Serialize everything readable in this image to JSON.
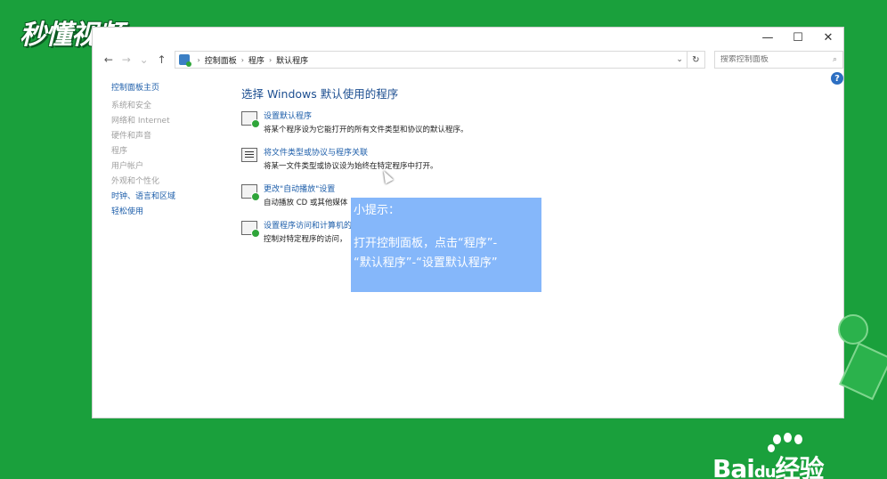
{
  "watermark": {
    "logo_text": "秒懂视频",
    "baidu_text": "Bai",
    "baidu_suffix": "经验",
    "du_text": "du"
  },
  "window": {
    "controls": {
      "minimize": "—",
      "maximize": "☐",
      "close": "✕"
    },
    "address": {
      "back": "←",
      "forward": "→",
      "recent": "⌄",
      "up": "↑",
      "breadcrumb": [
        "控制面板",
        "程序",
        "默认程序"
      ],
      "separator": "›",
      "dropdown": "⌄",
      "refresh": "↻"
    },
    "search": {
      "placeholder": "搜索控制面板",
      "icon": "⌕"
    },
    "help": "?"
  },
  "sidebar": {
    "home": "控制面板主页",
    "items": [
      {
        "label": "系统和安全"
      },
      {
        "label": "网络和 Internet"
      },
      {
        "label": "硬件和声音"
      },
      {
        "label": "程序"
      },
      {
        "label": "用户帐户"
      },
      {
        "label": "外观和个性化"
      },
      {
        "label": "时钟、语言和区域"
      },
      {
        "label": "轻松使用"
      }
    ]
  },
  "main": {
    "title": "选择 Windows 默认使用的程序",
    "tasks": [
      {
        "link": "设置默认程序",
        "desc": "将某个程序设为它能打开的所有文件类型和协议的默认程序。"
      },
      {
        "link": "将文件类型或协议与程序关联",
        "desc": "将某一文件类型或协议设为始终在特定程序中打开。"
      },
      {
        "link": "更改\"自动播放\"设置",
        "desc": "自动播放 CD 或其他媒体"
      },
      {
        "link": "设置程序访问和计算机的",
        "desc": "控制对特定程序的访问，"
      }
    ]
  },
  "tip": {
    "title": "小提示：",
    "line1": "打开控制面板，点击“程序”-",
    "line2": "“默认程序”-“设置默认程序”"
  }
}
